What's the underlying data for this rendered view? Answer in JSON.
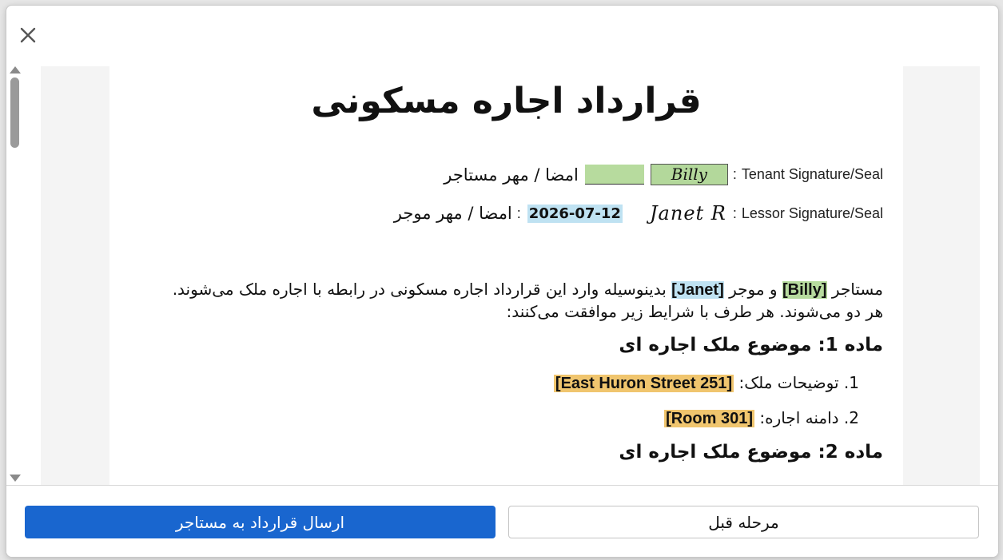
{
  "dialog": {
    "close_icon": "close-icon"
  },
  "document": {
    "title": "قرارداد اجاره مسکونی",
    "tenant_signature": {
      "label": "Tenant Signature/Seal",
      "colon": ":",
      "signature": "Billy",
      "fa_label": "امضا / مهر مستاجر"
    },
    "lessor_signature": {
      "label": "Lessor Signature/Seal",
      "colon": ":",
      "signature": "Janet R",
      "date": "2026-07-12",
      "date_colon": ":",
      "fa_label": "امضا / مهر موجر"
    },
    "intro": {
      "p1": "مستاجر",
      "tenant": "[Billy]",
      "p2": "و موجر",
      "lessor": "[Janet]",
      "p3": "بدینوسیله وارد این قرارداد اجاره مسکونی در رابطه با اجاره ملک می‌شوند. هر دو می‌شوند. هر طرف با شرایط زیر موافقت می‌کنند:"
    },
    "article1": {
      "heading": "ماده 1: موضوع ملک اجاره ای",
      "items": [
        {
          "num": "1.",
          "label": "توضیحات ملک:",
          "value": "[251 East Huron Street]"
        },
        {
          "num": "2.",
          "label": "دامنه اجاره:",
          "value": "[Room 301]"
        }
      ]
    },
    "article2": {
      "heading": "ماده 2: موضوع ملک اجاره ای"
    }
  },
  "footer": {
    "send_button": "ارسال قرارداد به مستاجر",
    "back_button": "مرحله قبل"
  },
  "colors": {
    "primary": "#1966cf",
    "highlight_green": "#b7db9e",
    "highlight_blue": "#bfe2f2",
    "highlight_orange": "#f0c56e"
  }
}
